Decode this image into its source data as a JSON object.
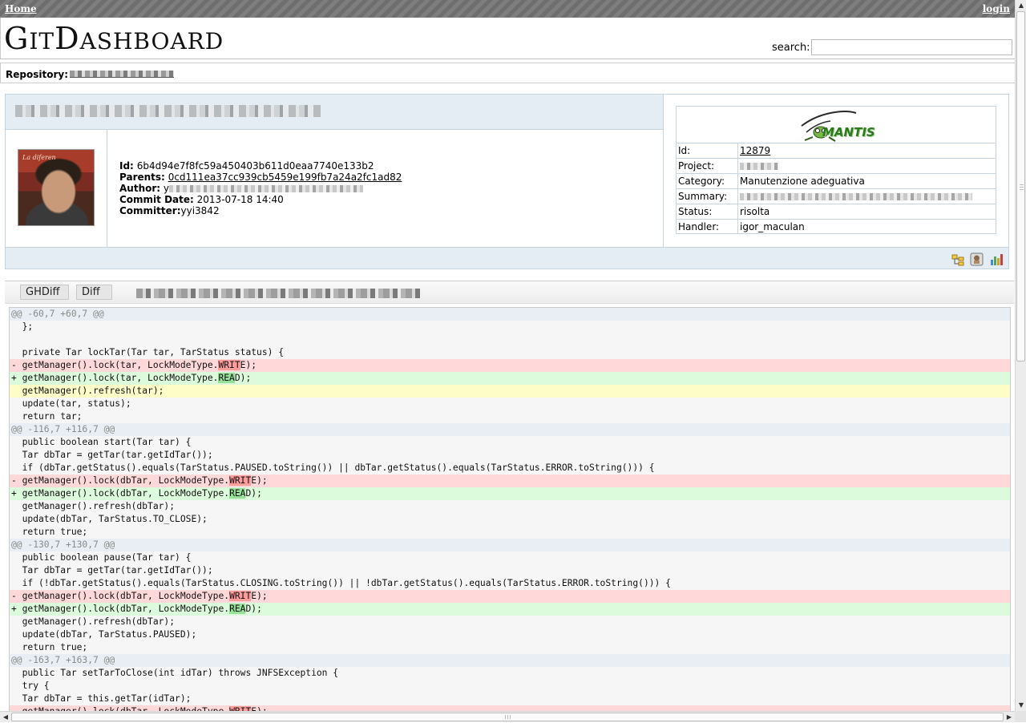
{
  "topbar": {
    "home_label": "Home",
    "login_label": "login"
  },
  "header": {
    "logo_text": "GitDashboard",
    "search_label": "search:",
    "search_value": ""
  },
  "repository": {
    "label": "Repository:"
  },
  "commit": {
    "id_label": "Id:",
    "id": "6b4d94e7f8fc59a450403b611d0eaa7740e133b2",
    "parents_label": "Parents:",
    "parents": "0cd111ea37cc939cb5459e199fb7a24a2fc1ad82",
    "author_label": "Author:",
    "author_visible": "y",
    "date_label": "Commit Date:",
    "date": "2013-07-18 14:40",
    "committer_label": "Committer:",
    "committer": "yyi3842",
    "avatar_caption": "La diferen"
  },
  "mantis": {
    "logo_text": "MANTIS",
    "rows": [
      {
        "key": "Id:",
        "value": "12879"
      },
      {
        "key": "Project:",
        "value": ""
      },
      {
        "key": "Category:",
        "value": "Manutenzione adeguativa"
      },
      {
        "key": "Summary:",
        "value": ""
      },
      {
        "key": "Status:",
        "value": "risolta"
      },
      {
        "key": "Handler:",
        "value": "igor_maculan"
      }
    ]
  },
  "footer_icons": [
    "tree-icon",
    "puzzle-icon",
    "chart-icon"
  ],
  "diff_tabs": [
    {
      "label": "GHDiff"
    },
    {
      "label": "Diff"
    }
  ],
  "diff_lines": [
    {
      "type": "hunk",
      "text": "@@ -60,7 +60,7 @@"
    },
    {
      "type": "ctx",
      "text": "  };"
    },
    {
      "type": "ctx",
      "text": ""
    },
    {
      "type": "ctx",
      "text": "  private Tar lockTar(Tar tar, TarStatus status) {"
    },
    {
      "type": "del",
      "pre": "- getManager().lock(tar, LockModeType.",
      "hl": "WRIT",
      "post": "E);"
    },
    {
      "type": "add",
      "pre": "+ getManager().lock(tar, LockModeType.",
      "hl": "REA",
      "post": "D);"
    },
    {
      "type": "chg",
      "text": "  getManager().refresh(tar);"
    },
    {
      "type": "ctx",
      "text": "  update(tar, status);"
    },
    {
      "type": "ctx",
      "text": "  return tar;"
    },
    {
      "type": "hunk",
      "text": "@@ -116,7 +116,7 @@"
    },
    {
      "type": "ctx",
      "text": "  public boolean start(Tar tar) {"
    },
    {
      "type": "ctx",
      "text": "  Tar dbTar = getTar(tar.getIdTar());"
    },
    {
      "type": "ctx",
      "text": "  if (dbTar.getStatus().equals(TarStatus.PAUSED.toString()) || dbTar.getStatus().equals(TarStatus.ERROR.toString())) {"
    },
    {
      "type": "del",
      "pre": "- getManager().lock(dbTar, LockModeType.",
      "hl": "WRIT",
      "post": "E);"
    },
    {
      "type": "add",
      "pre": "+ getManager().lock(dbTar, LockModeType.",
      "hl": "REA",
      "post": "D);"
    },
    {
      "type": "ctx",
      "text": "  getManager().refresh(dbTar);"
    },
    {
      "type": "ctx",
      "text": "  update(dbTar, TarStatus.TO_CLOSE);"
    },
    {
      "type": "ctx",
      "text": "  return true;"
    },
    {
      "type": "hunk",
      "text": "@@ -130,7 +130,7 @@"
    },
    {
      "type": "ctx",
      "text": "  public boolean pause(Tar tar) {"
    },
    {
      "type": "ctx",
      "text": "  Tar dbTar = getTar(tar.getIdTar());"
    },
    {
      "type": "ctx",
      "text": "  if (!dbTar.getStatus().equals(TarStatus.CLOSING.toString()) || !dbTar.getStatus().equals(TarStatus.ERROR.toString())) {"
    },
    {
      "type": "del",
      "pre": "- getManager().lock(dbTar, LockModeType.",
      "hl": "WRIT",
      "post": "E);"
    },
    {
      "type": "add",
      "pre": "+ getManager().lock(dbTar, LockModeType.",
      "hl": "REA",
      "post": "D);"
    },
    {
      "type": "ctx",
      "text": "  getManager().refresh(dbTar);"
    },
    {
      "type": "ctx",
      "text": "  update(dbTar, TarStatus.PAUSED);"
    },
    {
      "type": "ctx",
      "text": "  return true;"
    },
    {
      "type": "hunk",
      "text": "@@ -163,7 +163,7 @@"
    },
    {
      "type": "ctx",
      "text": "  public Tar setTarToClose(int idTar) throws JNFSException {"
    },
    {
      "type": "ctx",
      "text": "  try {"
    },
    {
      "type": "ctx",
      "text": "  Tar dbTar = this.getTar(idTar);"
    },
    {
      "type": "del",
      "pre": "- getManager().lock(dbTar, LockModeType.",
      "hl": "WRIT",
      "post": "E);"
    }
  ],
  "colors": {
    "panel_bg": "#e3edf3",
    "del_bg": "#ffd9d9",
    "add_bg": "#dcfadc",
    "chg_bg": "#fefdc7",
    "hunk_bg": "#e8eef3"
  }
}
